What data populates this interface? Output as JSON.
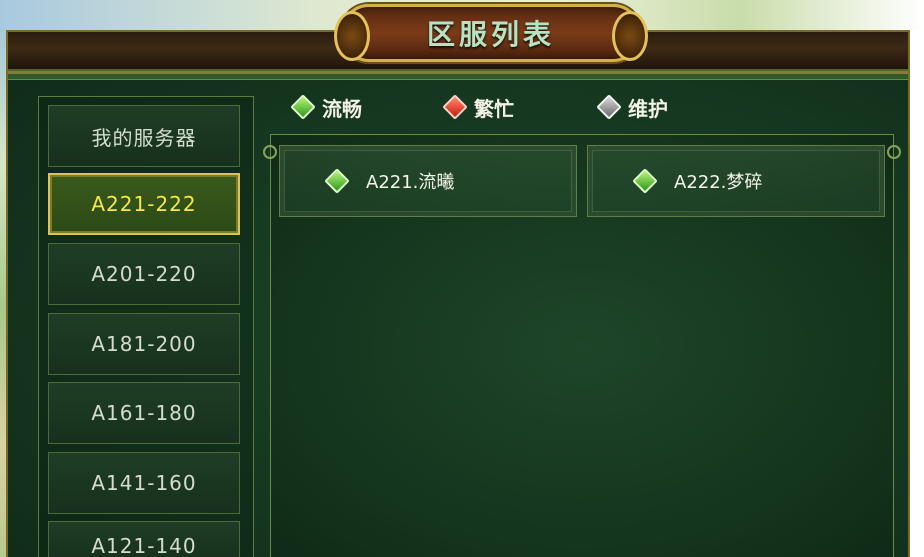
{
  "window": {
    "title": "区服列表"
  },
  "legend": [
    {
      "label": "流畅",
      "icon": "green-gem-icon",
      "color": "#3fae22"
    },
    {
      "label": "繁忙",
      "icon": "red-gem-icon",
      "color": "#d22a18"
    },
    {
      "label": "维护",
      "icon": "gray-gem-icon",
      "color": "#8a8a8a"
    }
  ],
  "server_groups": [
    {
      "label": "我的服务器",
      "active": false
    },
    {
      "label": "A221-222",
      "active": true
    },
    {
      "label": "A201-220",
      "active": false
    },
    {
      "label": "A181-200",
      "active": false
    },
    {
      "label": "A161-180",
      "active": false
    },
    {
      "label": "A141-160",
      "active": false
    },
    {
      "label": "A121-140",
      "active": false
    }
  ],
  "servers": [
    {
      "label": "A221.流曦",
      "status": "流畅",
      "icon": "green-gem-icon"
    },
    {
      "label": "A222.梦碎",
      "status": "流畅",
      "icon": "green-gem-icon"
    }
  ],
  "colors": {
    "active_text": "#f5e84a",
    "title_text": "#b6e3c4",
    "gold_border": "#d4b04a"
  }
}
